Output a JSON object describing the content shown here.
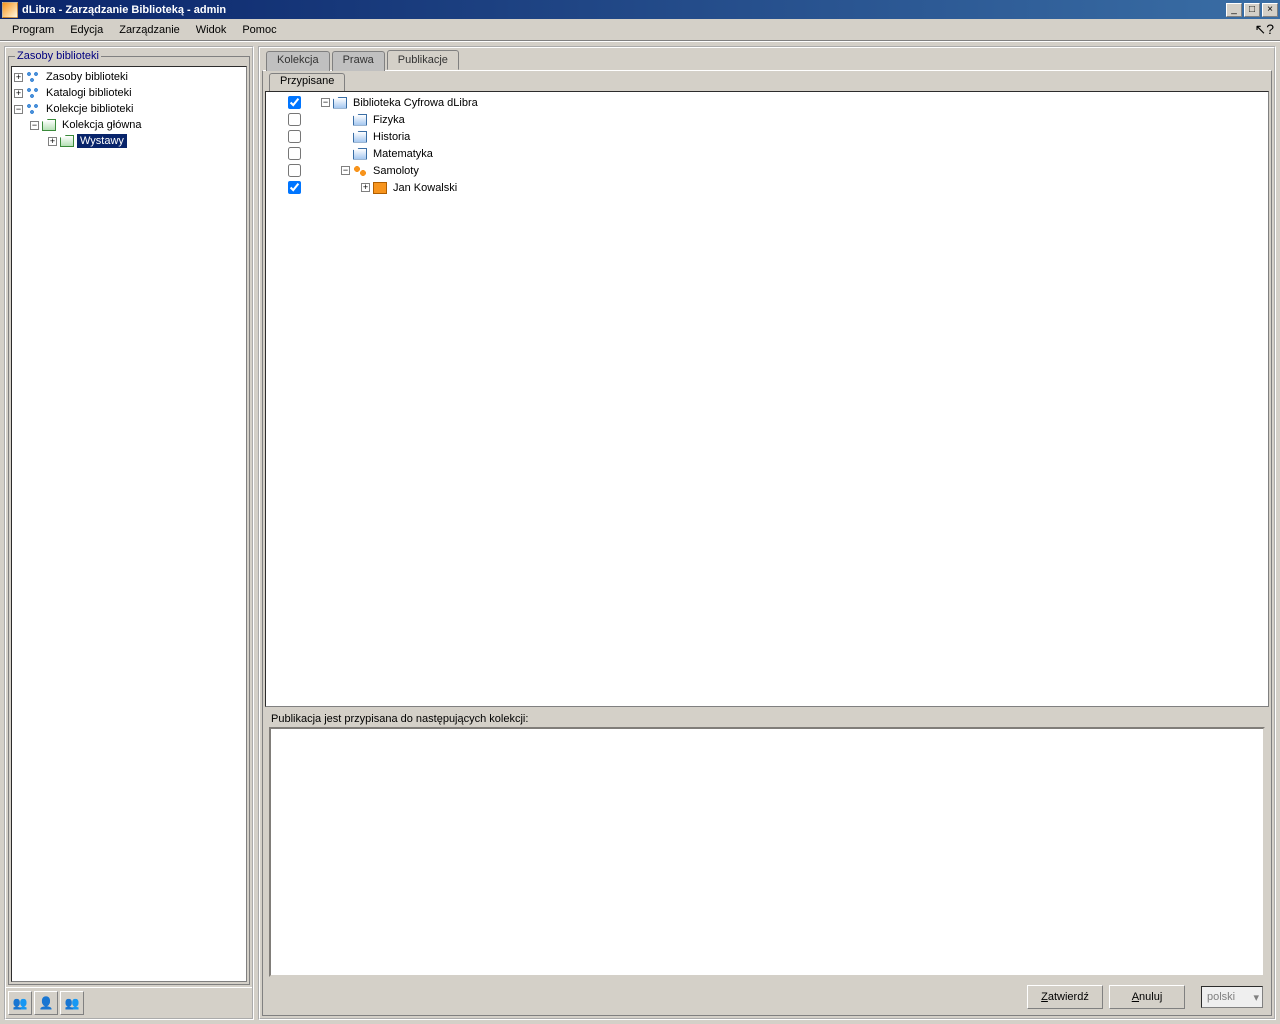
{
  "window": {
    "title": "dLibra - Zarządzanie Biblioteką - admin"
  },
  "menu": {
    "program": "Program",
    "edycja": "Edycja",
    "zarzadzanie": "Zarządzanie",
    "widok": "Widok",
    "pomoc": "Pomoc"
  },
  "sidebar": {
    "legend": "Zasoby biblioteki",
    "tree": {
      "root1": "Zasoby biblioteki",
      "root2": "Katalogi biblioteki",
      "root3": "Kolekcje biblioteki",
      "child_main": "Kolekcja główna",
      "child_exhibit": "Wystawy"
    }
  },
  "tabs": {
    "kolekcja": "Kolekcja",
    "prawa": "Prawa",
    "publikacje": "Publikacje"
  },
  "subtab": {
    "przypisane": "Przypisane"
  },
  "assign": {
    "items": [
      {
        "label": "Biblioteka Cyfrowa dLibra",
        "checked": true,
        "indent": 0,
        "expander": "−",
        "icon": "folder-blue"
      },
      {
        "label": "Fizyka",
        "checked": false,
        "indent": 1,
        "expander": "",
        "icon": "folder-blue"
      },
      {
        "label": "Historia",
        "checked": false,
        "indent": 1,
        "expander": "",
        "icon": "folder-blue"
      },
      {
        "label": "Matematyka",
        "checked": false,
        "indent": 1,
        "expander": "",
        "icon": "folder-blue"
      },
      {
        "label": "Samoloty",
        "checked": false,
        "indent": 1,
        "expander": "−",
        "icon": "group"
      },
      {
        "label": "Jan Kowalski",
        "checked": true,
        "indent": 2,
        "expander": "+",
        "icon": "book"
      }
    ]
  },
  "lower": {
    "label": "Publikacja jest przypisana do następujących kolekcji:"
  },
  "buttons": {
    "ok": "Zatwierdź",
    "ok_u": "Z",
    "cancel": "Anuluj",
    "cancel_u": "A",
    "lang": "polski"
  }
}
